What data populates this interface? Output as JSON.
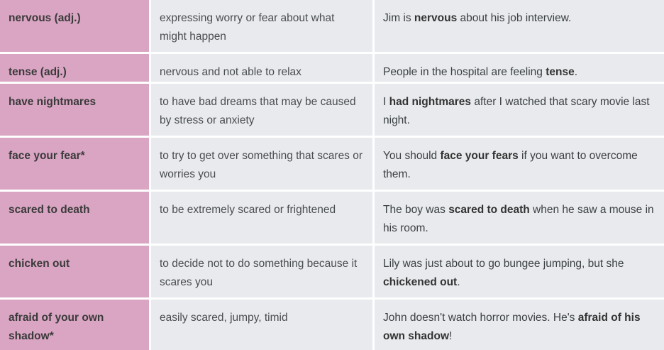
{
  "rows": [
    {
      "term": "nervous (adj.)",
      "definition": "expressing worry or fear about what might happen",
      "example": {
        "pre": "Jim is ",
        "bold": "nervous",
        "post": " about his job interview."
      }
    },
    {
      "term": "tense (adj.)",
      "definition": "nervous and not able to relax",
      "example": {
        "pre": "People in the hospital are feeling ",
        "bold": "tense",
        "post": "."
      }
    },
    {
      "term": "have nightmares",
      "definition": "to have bad dreams that may be caused by stress or anxiety",
      "example": {
        "pre": "I ",
        "bold": "had nightmares",
        "post": " after I watched that scary movie last night."
      }
    },
    {
      "term": "face your fear*",
      "definition": "to try to get over something that scares or worries you",
      "example": {
        "pre": "You should ",
        "bold": "face your fears",
        "post": " if you want to overcome them."
      }
    },
    {
      "term": "scared to death",
      "definition": "to be extremely scared or frightened",
      "example": {
        "pre": "The boy was ",
        "bold": "scared to death",
        "post": " when he saw a mouse in his room."
      }
    },
    {
      "term": "chicken out",
      "definition": "to decide not to do something because it scares you",
      "example": {
        "pre": "Lily was just about to go bungee jumping, but she ",
        "bold": "chickened out",
        "post": "."
      }
    },
    {
      "term": "afraid of your own shadow*",
      "definition": "easily scared, jumpy, timid",
      "example": {
        "pre": "John doesn't watch horror movies. He's ",
        "bold": "afraid of his own shadow",
        "post": "!"
      }
    }
  ]
}
